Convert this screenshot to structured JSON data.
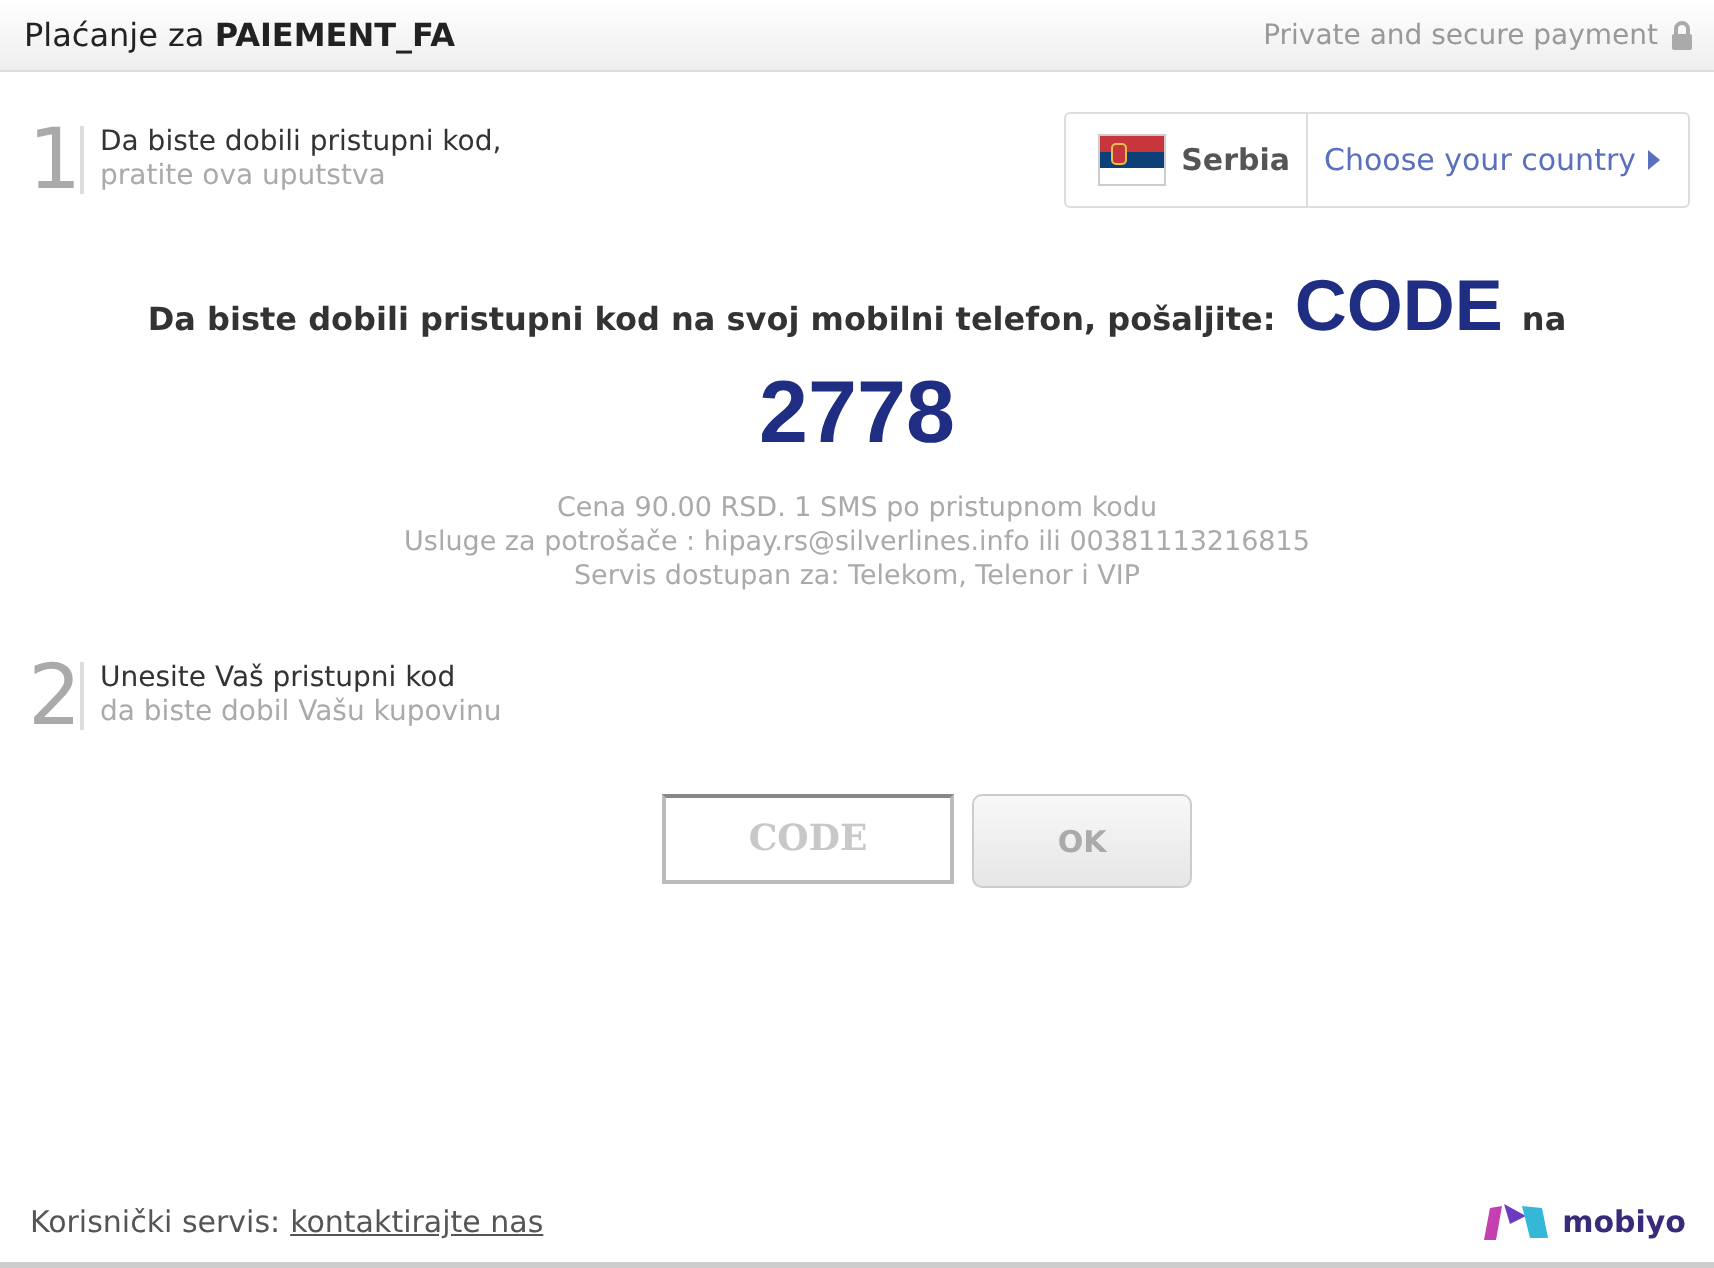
{
  "header": {
    "title_prefix": "Plaćanje za",
    "title_product": "PAIEMENT_FA",
    "secure_note": "Private and secure payment"
  },
  "step1": {
    "number": "1",
    "line1": "Da biste dobili pristupni kod,",
    "line2": "pratite ova uputstva"
  },
  "country": {
    "name": "Serbia",
    "choose_link": "Choose your country"
  },
  "instruction": {
    "before": "Da biste dobili pristupni kod na svoj mobilni telefon, pošaljite:",
    "keyword": "CODE",
    "after": "na",
    "number": "2778"
  },
  "details": [
    "Cena 90.00 RSD. 1 SMS po pristupnom kodu",
    "Usluge za potrošače : hipay.rs@silverlines.info ili 00381113216815",
    "Servis dostupan za: Telekom, Telenor i VIP"
  ],
  "step2": {
    "number": "2",
    "line1": "Unesite Vaš pristupni kod",
    "line2": "da biste dobil Vašu kupovinu"
  },
  "code_field": {
    "placeholder": "CODE"
  },
  "ok_button": {
    "label": "OK",
    "disabled": true
  },
  "footer": {
    "label": "Korisnički servis:",
    "link": "kontaktirajte nas",
    "brand": "mobiyo"
  }
}
